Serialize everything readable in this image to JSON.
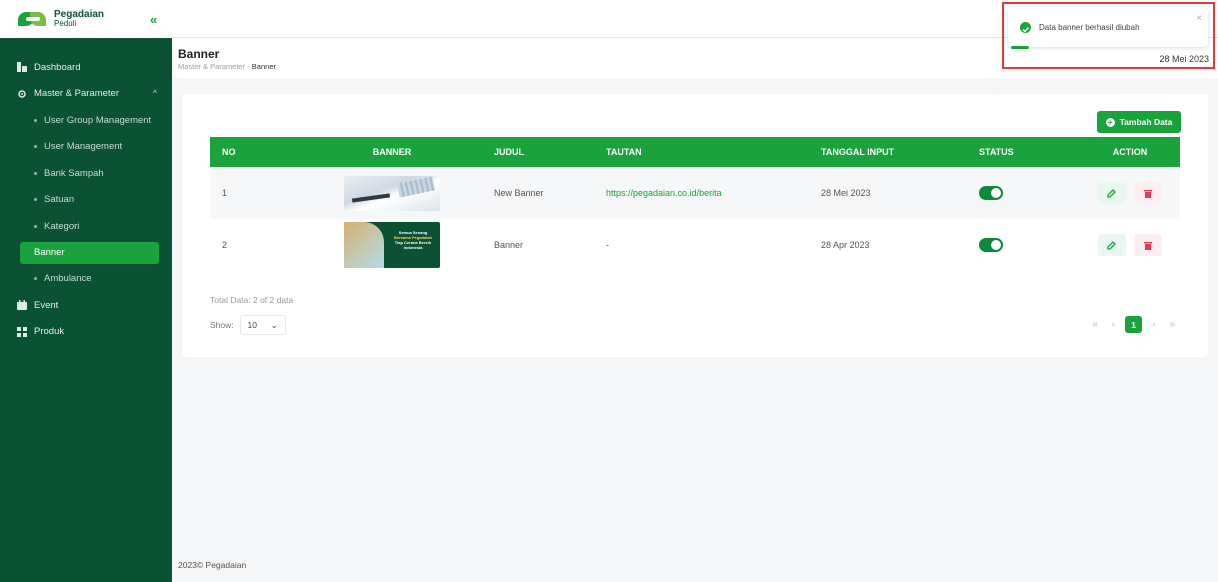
{
  "brand": {
    "name": "Pegadaian",
    "sub": "Peduli",
    "collapse": "«"
  },
  "sidebar": {
    "items": [
      {
        "label": "Dashboard"
      },
      {
        "label": "Master & Parameter"
      },
      {
        "label": "User Group Management"
      },
      {
        "label": "User Management"
      },
      {
        "label": "Bank Sampah"
      },
      {
        "label": "Satuan"
      },
      {
        "label": "Kategori"
      },
      {
        "label": "Banner"
      },
      {
        "label": "Ambulance"
      },
      {
        "label": "Event"
      },
      {
        "label": "Produk"
      }
    ]
  },
  "header": {
    "title": "Banner",
    "breadcrumb_parent": "Master & Parameter",
    "breadcrumb_sep": "-",
    "breadcrumb_current": "Banner",
    "date": "28 Mei 2023"
  },
  "toolbar": {
    "add_label": "Tambah Data"
  },
  "table": {
    "headers": [
      "NO",
      "BANNER",
      "JUDUL",
      "TAUTAN",
      "TANGGAL INPUT",
      "STATUS",
      "ACTION"
    ],
    "rows": [
      {
        "no": "1",
        "judul": "New Banner",
        "tautan": "https://pegadaian.co.id/berita",
        "tanggal": "28 Mei 2023",
        "status": true
      },
      {
        "no": "2",
        "judul": "Banner",
        "tautan": "-",
        "tanggal": "28 Apr 2023",
        "status": true
      }
    ],
    "banner2_text": {
      "l1": "Semua Senang",
      "l2": "Bersama Pegadaian",
      "l3": "Tiap Cerana Bersih Indonesia"
    }
  },
  "footer_info": {
    "total": "Total Data: 2 of 2 data",
    "show_label": "Show:",
    "show_value": "10",
    "page_current": "1",
    "pager": {
      "first": "«",
      "prev": "‹",
      "next": "›",
      "last": "»"
    }
  },
  "toast": {
    "message": "Data banner berhasil diubah",
    "close": "×",
    "progress": 0.1
  },
  "copyright": "2023© Pegadaian",
  "colors": {
    "primary": "#1aa23c",
    "sidebar": "#0b5134",
    "danger": "#e6395a",
    "highlight_border": "#e23a3a"
  }
}
